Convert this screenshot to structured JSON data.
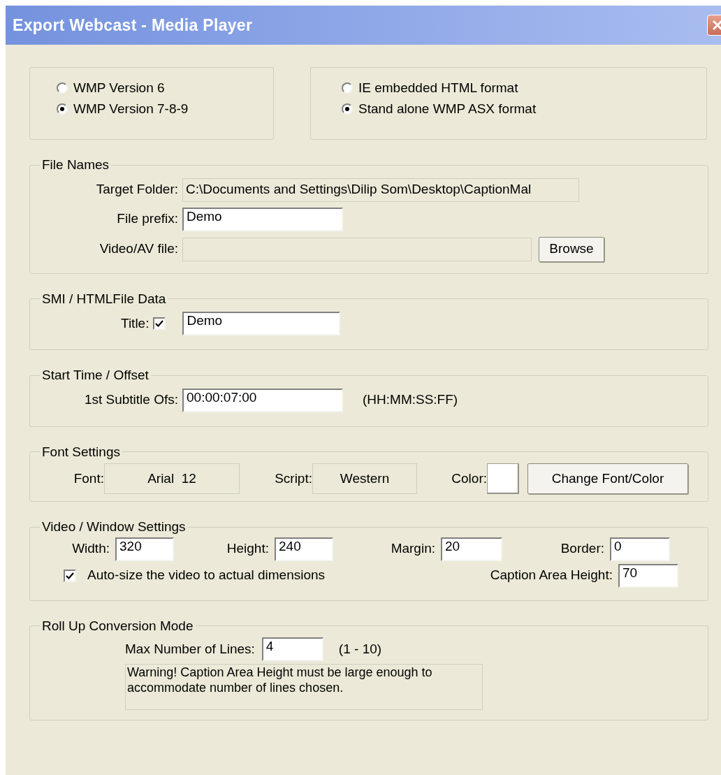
{
  "window": {
    "title": "Export Webcast - Media Player"
  },
  "player_version": [
    {
      "label": "WMP Version 6",
      "selected": false
    },
    {
      "label": "WMP Version 7-8-9",
      "selected": true
    }
  ],
  "output_format": [
    {
      "label": "IE embedded HTML format",
      "selected": false
    },
    {
      "label": "Stand alone WMP ASX format",
      "selected": true
    }
  ],
  "file_names": {
    "legend": "File Names",
    "target_folder": {
      "label": "Target Folder:",
      "value": "C:\\Documents and Settings\\Dilip Som\\Desktop\\CaptionMal"
    },
    "file_prefix": {
      "label": "File prefix:",
      "value": "Demo"
    },
    "video_file": {
      "label": "Video/AV file:",
      "disabled": true
    },
    "browse_button": "Browse"
  },
  "smi": {
    "legend": "SMI / HTMLFile Data",
    "title": {
      "label": "Title:",
      "checked": true,
      "value": "Demo"
    }
  },
  "start_time": {
    "legend": "Start Time / Offset",
    "first_subtitle_offset": {
      "label": "1st Subtitle Ofs:",
      "value": "00:00:07:00"
    },
    "format_hint": "(HH:MM:SS:FF)"
  },
  "font_settings": {
    "legend": "Font Settings",
    "font": {
      "label": "Font:",
      "value": "Arial  12"
    },
    "script": {
      "label": "Script:",
      "value": "Western"
    },
    "color": {
      "label": "Color:",
      "color": "#ffffff"
    },
    "change_button": "Change Font/Color"
  },
  "video_window": {
    "legend": "Video / Window Settings",
    "fields": [
      {
        "label": "Width:",
        "value": "320"
      },
      {
        "label": "Height:",
        "value": "240"
      },
      {
        "label": "Margin:",
        "value": "20"
      },
      {
        "label": "Border:",
        "value": "0"
      }
    ],
    "auto_size": {
      "label": "Auto-size the video to actual dimensions",
      "checked": true
    },
    "caption_area_height": {
      "label": "Caption Area Height:",
      "value": "70"
    }
  },
  "roll_up": {
    "legend": "Roll Up Conversion Mode",
    "max_lines": {
      "label": "Max Number of Lines:",
      "value": "4"
    },
    "range_hint": "(1 - 10)",
    "warning": "Warning! Caption Area Height must be large enough to accommodate number of lines chosen."
  }
}
